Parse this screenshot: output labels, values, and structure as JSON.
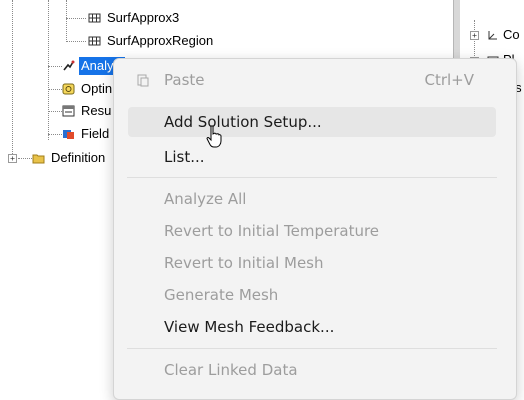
{
  "tree": {
    "items": [
      {
        "label": "SurfApprox3",
        "icon": "surface-approximation-icon"
      },
      {
        "label": "SurfApproxRegion",
        "icon": "surface-approximation-icon"
      },
      {
        "label": "Analysi",
        "icon": "analysis-icon",
        "selected": true
      },
      {
        "label": "Optin",
        "icon": "optimetrics-icon"
      },
      {
        "label": "Resu",
        "icon": "results-icon"
      },
      {
        "label": "Field",
        "icon": "field-overlays-icon"
      },
      {
        "label": "Definition",
        "icon": "folder-icon",
        "expander": "+"
      }
    ]
  },
  "right_panel": {
    "items": [
      {
        "label": "Co",
        "icon": "coordinate-system-icon",
        "expander": "+"
      },
      {
        "label": "Pl",
        "icon": "planes-icon"
      },
      {
        "label": "Lis",
        "icon": "lists-icon"
      }
    ]
  },
  "context_menu": {
    "items": [
      {
        "label": "Paste",
        "shortcut": "Ctrl+V",
        "state": "disabled",
        "icon": "paste-icon"
      },
      {
        "label": "Add Solution Setup...",
        "state": "enabled",
        "hover": true
      },
      {
        "label": "List...",
        "state": "enabled"
      },
      {
        "label": "Analyze All",
        "state": "disabled"
      },
      {
        "label": "Revert to Initial Temperature",
        "state": "disabled"
      },
      {
        "label": "Revert to Initial Mesh",
        "state": "disabled"
      },
      {
        "label": "Generate Mesh",
        "state": "disabled"
      },
      {
        "label": "View Mesh Feedback...",
        "state": "enabled"
      },
      {
        "label": "Clear Linked Data",
        "state": "disabled"
      }
    ]
  },
  "colors": {
    "selection": "#1673e8",
    "menu_background": "#f3f3f3",
    "menu_hover": "#e6e6e6",
    "disabled_text": "#9d9d9d",
    "folder_yellow": "#e8c24a"
  }
}
